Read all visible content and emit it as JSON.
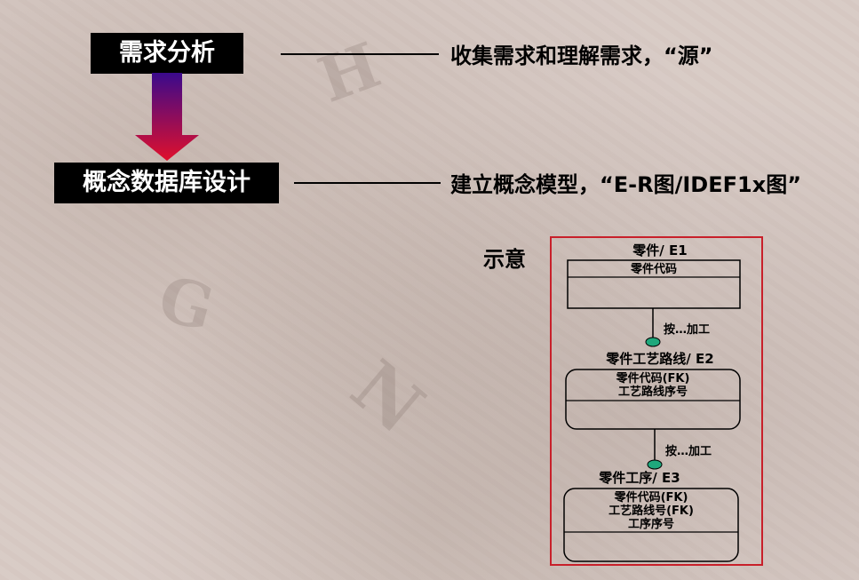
{
  "stages": [
    {
      "label": "需求分析",
      "description": "收集需求和理解需求，“源”"
    },
    {
      "label": "概念数据库设计",
      "description": "建立概念模型，“E-R图/IDEF1x图”"
    }
  ],
  "illustration": {
    "label": "示意",
    "entities": [
      {
        "title": "零件/ E1",
        "attributes": [
          "零件代码"
        ],
        "rounded": false
      },
      {
        "title": "零件工艺路线/ E2",
        "attributes": [
          "零件代码(FK)",
          "工艺路线序号"
        ],
        "rounded": true
      },
      {
        "title": "零件工序/ E3",
        "attributes": [
          "零件代码(FK)",
          "工艺路线号(FK)",
          "工序序号"
        ],
        "rounded": true
      }
    ],
    "relationships": [
      {
        "label": "按…加工"
      },
      {
        "label": "按…加工"
      }
    ]
  },
  "colors": {
    "stage_box": "#000000",
    "arrow_top": "#3a0a8c",
    "arrow_bottom": "#e0102c",
    "frame": "#c8202a",
    "connector_dot": "#1fa87c"
  }
}
